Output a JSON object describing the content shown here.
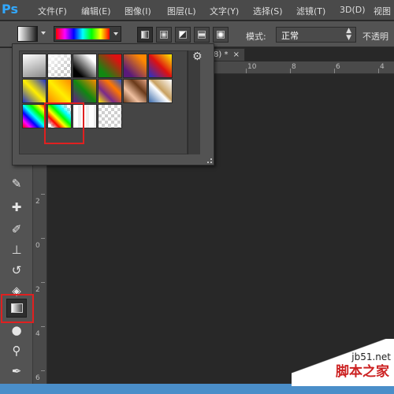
{
  "app": {
    "logo": "Ps"
  },
  "menu": [
    {
      "label": "文件(F)"
    },
    {
      "label": "编辑(E)"
    },
    {
      "label": "图像(I)"
    },
    {
      "label": "图层(L)"
    },
    {
      "label": "文字(Y)"
    },
    {
      "label": "选择(S)"
    },
    {
      "label": "滤镜(T)"
    },
    {
      "label": "3D(D)"
    },
    {
      "label": "视图"
    }
  ],
  "options": {
    "mode_label": "模式:",
    "mode_value": "正常",
    "opacity_label": "不透明"
  },
  "document": {
    "tab_text": "8) *",
    "close": "×"
  },
  "ruler_h": [
    "10",
    "8",
    "6",
    "4"
  ],
  "ruler_v": [
    "2",
    "0",
    "2",
    "4",
    "6"
  ],
  "gradient_presets": {
    "selected_index": 13,
    "items": [
      {
        "name": "foreground-to-background"
      },
      {
        "name": "foreground-to-transparent"
      },
      {
        "name": "black-white"
      },
      {
        "name": "red-green"
      },
      {
        "name": "violet-orange"
      },
      {
        "name": "blue-red-yellow"
      },
      {
        "name": "blue-yellow-blue"
      },
      {
        "name": "orange-yellow-orange"
      },
      {
        "name": "violet-green-orange"
      },
      {
        "name": "yellow-violet-orange-blue"
      },
      {
        "name": "copper"
      },
      {
        "name": "chrome"
      },
      {
        "name": "spectrum"
      },
      {
        "name": "transparent-rainbow"
      },
      {
        "name": "transparent-stripes"
      },
      {
        "name": "transparent-checker"
      }
    ]
  },
  "watermark": {
    "site": "jb51.net",
    "text": "脚本之家"
  },
  "colors": {
    "highlight": "#e02020",
    "accent": "#31a8ff"
  }
}
